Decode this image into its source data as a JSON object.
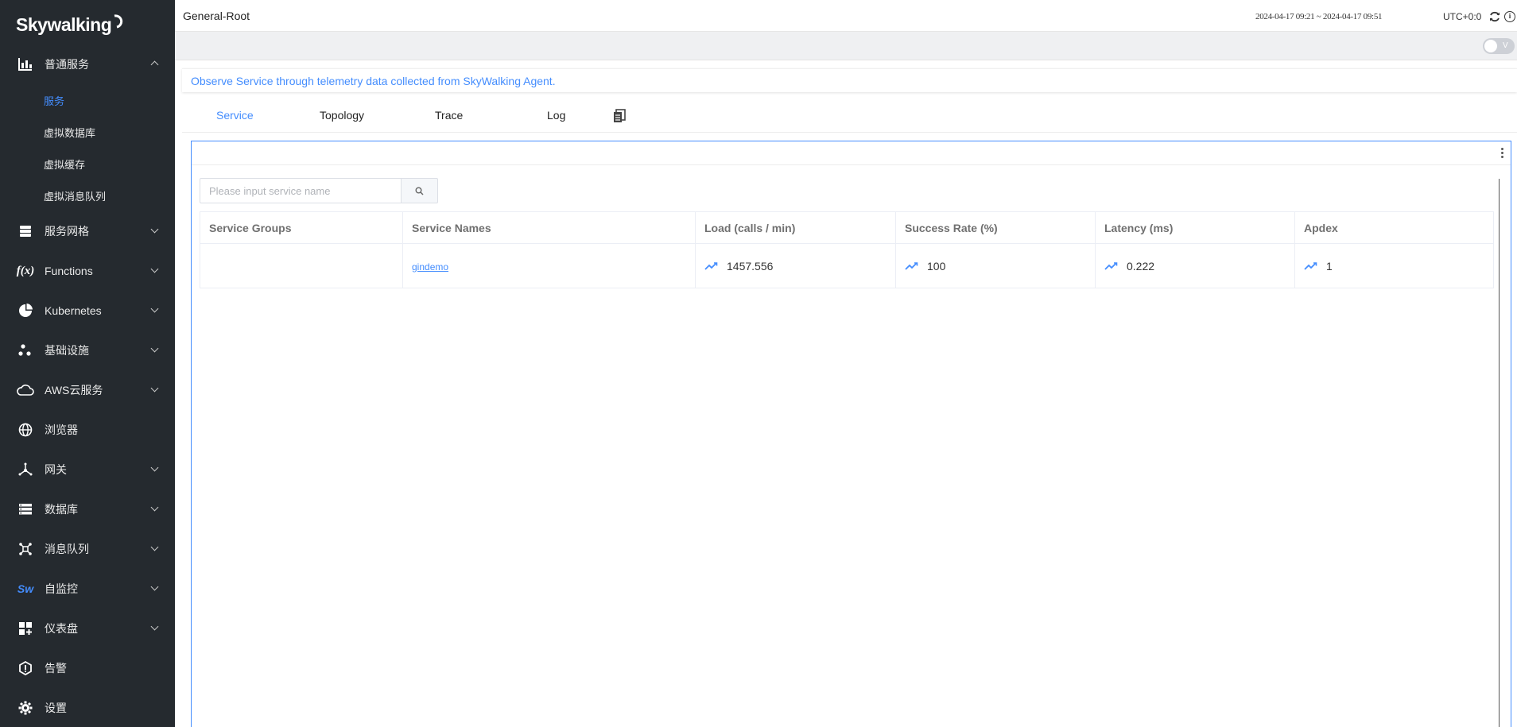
{
  "sidebar": {
    "logo": "Skywalking",
    "groups": [
      {
        "label": "普通服务",
        "icon": "chart-bar-icon"
      },
      {
        "label": "服务网格",
        "icon": "layers-icon"
      },
      {
        "label": "Functions",
        "icon": "function-icon"
      },
      {
        "label": "Kubernetes",
        "icon": "pie-chart-icon"
      },
      {
        "label": "基础设施",
        "icon": "nodes-icon"
      },
      {
        "label": "AWS云服务",
        "icon": "cloud-icon"
      },
      {
        "label": "浏览器",
        "icon": "globe-icon"
      },
      {
        "label": "网关",
        "icon": "gateway-icon"
      },
      {
        "label": "数据库",
        "icon": "database-icon"
      },
      {
        "label": "消息队列",
        "icon": "message-queue-icon"
      },
      {
        "label": "自监控",
        "icon": "sw-logo-icon"
      },
      {
        "label": "仪表盘",
        "icon": "dashboard-grid-icon"
      },
      {
        "label": "告警",
        "icon": "alarm-shield-icon"
      },
      {
        "label": "设置",
        "icon": "gear-icon"
      }
    ],
    "sub_items": [
      "服务",
      "虚拟数据库",
      "虚拟缓存",
      "虚拟消息队列"
    ],
    "icon_text": {
      "sw": "Sw",
      "fx": "f(x)"
    }
  },
  "header": {
    "title": "General-Root",
    "time_range": "2024-04-17 09:21 ~ 2024-04-17 09:51",
    "timezone": "UTC+0:0"
  },
  "subbar": {
    "toggle_label": "V"
  },
  "description": "Observe Service through telemetry data collected from SkyWalking Agent.",
  "tabs": [
    "Service",
    "Topology",
    "Trace",
    "Log"
  ],
  "search": {
    "placeholder": "Please input service name",
    "value": ""
  },
  "table": {
    "columns": [
      "Service Groups",
      "Service Names",
      "Load (calls / min)",
      "Success Rate (%)",
      "Latency (ms)",
      "Apdex"
    ],
    "rows": [
      {
        "group": "",
        "name": "gindemo",
        "load": "1457.556",
        "success_rate": "100",
        "latency": "0.222",
        "apdex": "1"
      }
    ]
  },
  "colors": {
    "accent": "#448dfe",
    "sidebar_bg": "#252a2f"
  }
}
